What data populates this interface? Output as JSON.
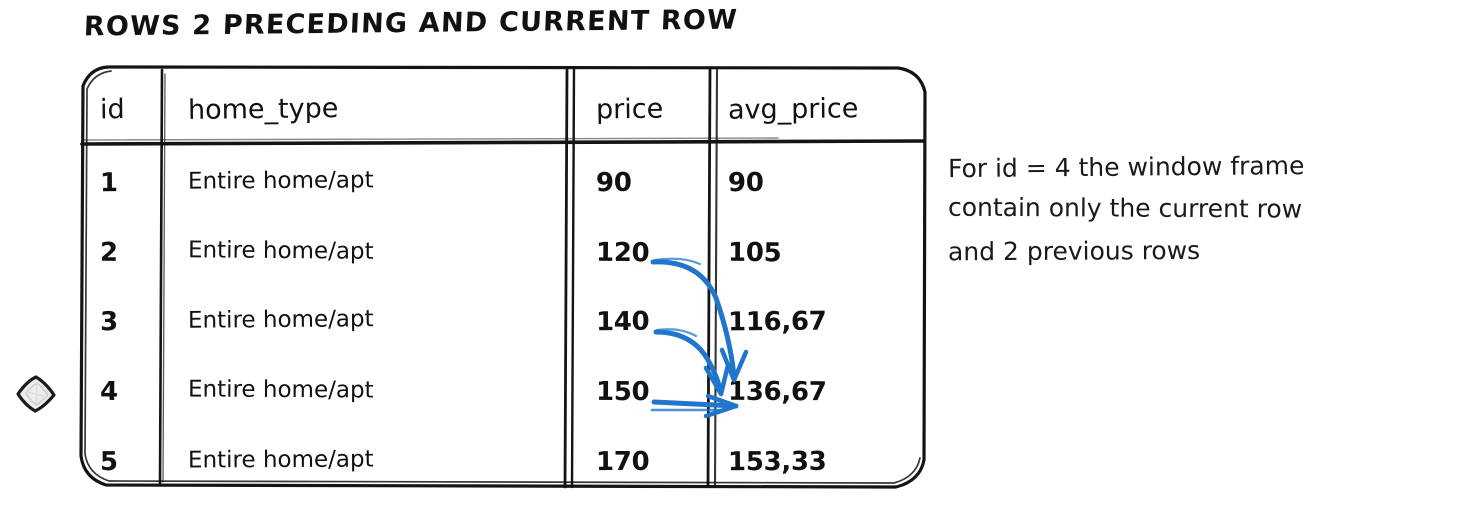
{
  "title": "ROWS 2 PRECEDING AND CURRENT ROW",
  "marker": {
    "name": "diamond-marker",
    "row_ref": "4"
  },
  "table": {
    "columns": [
      "id",
      "home_type",
      "price",
      "avg_price"
    ],
    "rows": [
      {
        "id": "1",
        "home_type": "Entire home/apt",
        "price": "90",
        "avg_price": "90"
      },
      {
        "id": "2",
        "home_type": "Entire home/apt",
        "price": "120",
        "avg_price": "105"
      },
      {
        "id": "3",
        "home_type": "Entire home/apt",
        "price": "140",
        "avg_price": "116,67"
      },
      {
        "id": "4",
        "home_type": "Entire home/apt",
        "price": "150",
        "avg_price": "136,67"
      },
      {
        "id": "5",
        "home_type": "Entire home/apt",
        "price": "170",
        "avg_price": "153,33"
      }
    ]
  },
  "annotation": {
    "line1": "For id = 4 the window frame",
    "line2": "contain only the current row",
    "line3": "and 2 previous rows"
  },
  "arrows": {
    "color": "#2176cc",
    "from": [
      "120",
      "140",
      "150"
    ],
    "to": "136,67"
  },
  "colors": {
    "ink": "#111111",
    "accent_blue": "#2176cc",
    "background": "#ffffff",
    "marker_fill": "#ededed"
  }
}
